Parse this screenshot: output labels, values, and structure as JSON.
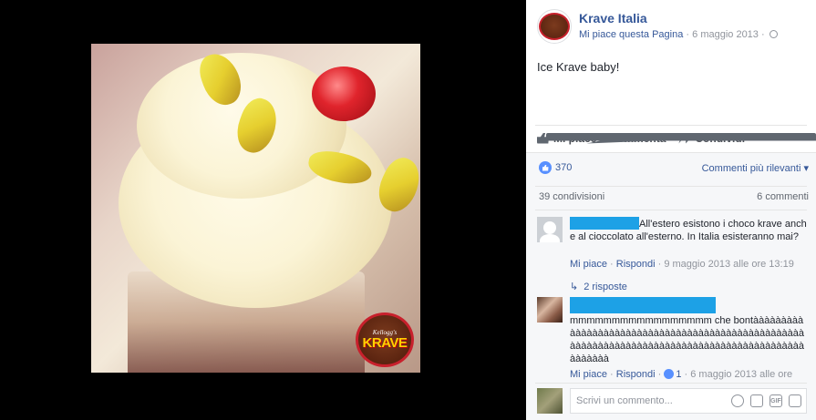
{
  "post": {
    "page_name": "Krave Italia",
    "like_page": "Mi piace questa Pagina",
    "date": "6 maggio 2013",
    "text": "Ice Krave baby!"
  },
  "photo": {
    "badge_brand": "Kellogg's",
    "badge_name": "KRAVE"
  },
  "actions": {
    "like": "Mi piace",
    "comment": "Commenta",
    "share": "Condividi"
  },
  "stats": {
    "likes": "370",
    "sort": "Commenti più rilevanti",
    "shares": "39 condivisioni",
    "comments": "6 commenti"
  },
  "comments": [
    {
      "text": "All'estero esistono i choco krave anche al cioccolato all'esterno. In Italia esisteranno mai?",
      "like": "Mi piace",
      "reply": "Rispondi",
      "time": "9 maggio 2013 alle ore 13:19",
      "replies": "2 risposte"
    },
    {
      "text": "mmmmmmmmmmmmmmmmm che bontàààààààààààààààààààààààààààààààààààààààààààààààààààààààààààààààààààààààààààààààààààààààààààààààààààà",
      "like": "Mi piace",
      "reply": "Rispondi",
      "likes": "1",
      "time": "6 maggio 2013 alle ore"
    }
  ],
  "composer": {
    "placeholder": "Scrivi un commento..."
  },
  "colors": {
    "link": "#365899",
    "redaction": "#1da1e6",
    "like_blue": "#5890ff"
  }
}
